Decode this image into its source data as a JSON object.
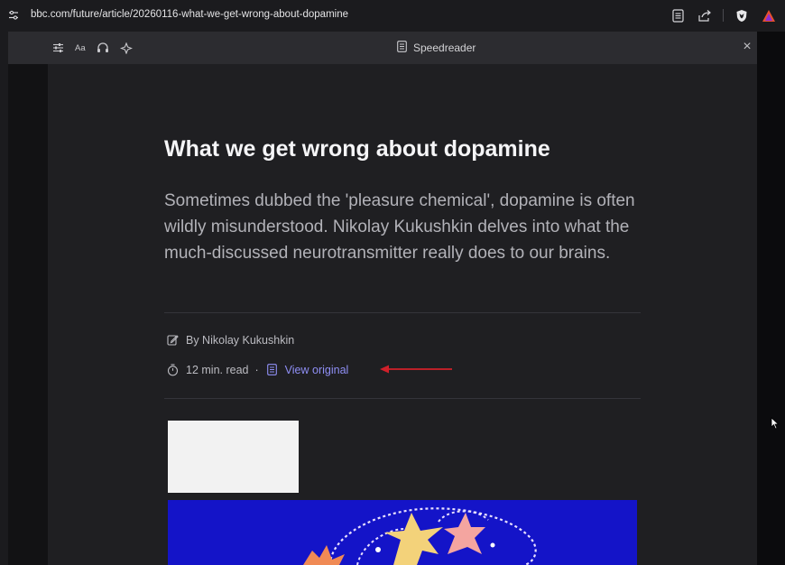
{
  "browser": {
    "url": "bbc.com/future/article/20260116-what-we-get-wrong-about-dopamine"
  },
  "speedreader": {
    "title": "Speedreader",
    "tools": [
      "sliders-icon",
      "font-size-icon",
      "headphones-icon",
      "sparkle-icon"
    ],
    "font_tool_label": "Aa",
    "close_label": "×"
  },
  "article": {
    "title": "What we get wrong about dopamine",
    "subtitle": "Sometimes dubbed the 'pleasure chemical', dopamine is often wildly misunderstood. Nikolay Kukushkin delves into what the much-discussed neurotransmitter really does to our brains.",
    "byline": "By Nikolay Kukushkin",
    "read_time": "12 min. read",
    "separator": "·",
    "view_original": "View original"
  },
  "colors": {
    "link": "#8f8ff5",
    "annotation_arrow": "#d0202a",
    "hero_image_background": "#1414c8"
  }
}
